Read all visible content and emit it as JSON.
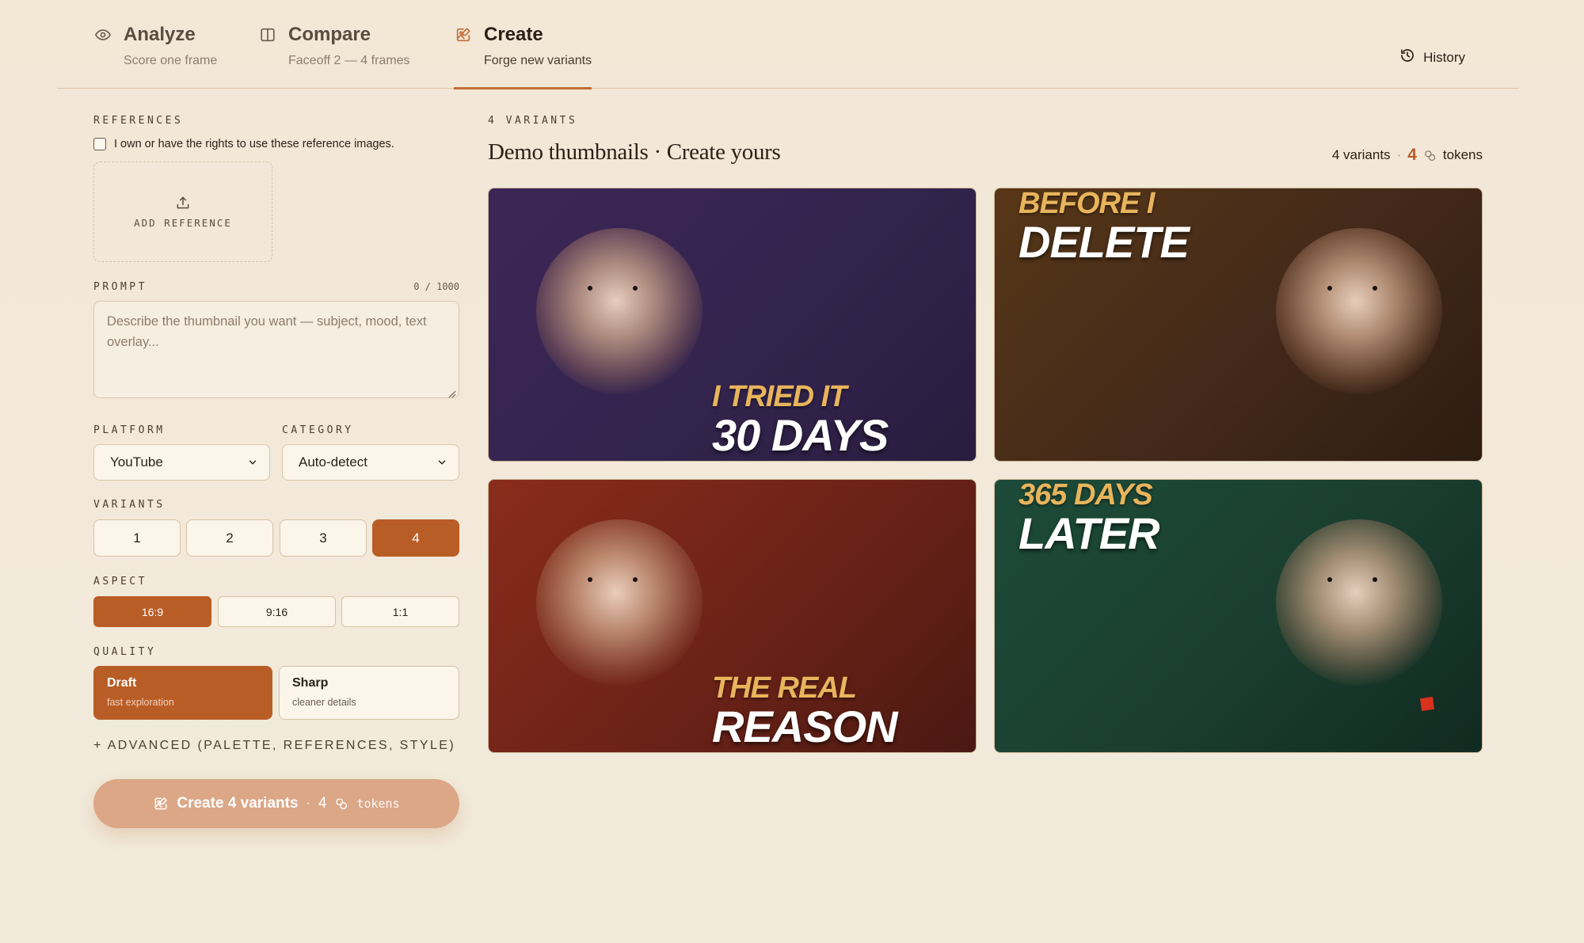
{
  "nav": {
    "tabs": [
      {
        "label": "Analyze",
        "sub": "Score one frame",
        "icon": "eye-icon"
      },
      {
        "label": "Compare",
        "sub": "Faceoff 2 — 4 frames",
        "icon": "columns-icon"
      },
      {
        "label": "Create",
        "sub": "Forge new variants",
        "icon": "image-edit-icon",
        "active": true
      }
    ],
    "history_label": "History"
  },
  "left": {
    "references_label": "REFERENCES",
    "rights_text": "I own or have the rights to use these reference images.",
    "add_reference_label": "ADD REFERENCE",
    "prompt_label": "PROMPT",
    "prompt_counter": "0 / 1000",
    "prompt_placeholder": "Describe the thumbnail you want — subject, mood, text overlay...",
    "platform_label": "PLATFORM",
    "platform_value": "YouTube",
    "category_label": "CATEGORY",
    "category_value": "Auto-detect",
    "variants_label": "VARIANTS",
    "variant_options": [
      "1",
      "2",
      "3",
      "4"
    ],
    "variant_selected": "4",
    "aspect_label": "ASPECT",
    "aspect_options": [
      "16:9",
      "9:16",
      "1:1"
    ],
    "aspect_selected": "16:9",
    "quality_label": "QUALITY",
    "quality_options": [
      {
        "title": "Draft",
        "sub": "fast exploration"
      },
      {
        "title": "Sharp",
        "sub": "cleaner details"
      }
    ],
    "quality_selected": "Draft",
    "advanced_label": "+ ADVANCED (PALETTE, REFERENCES, STYLE)",
    "create_button": {
      "label": "Create 4 variants",
      "separator": "·",
      "count": "4",
      "tokens": "tokens"
    }
  },
  "right": {
    "count_label": "4 VARIANTS",
    "headline": "Demo thumbnails · Create yours",
    "meta_variants": "4 variants",
    "meta_sep": "·",
    "meta_count": "4",
    "meta_tokens": "tokens",
    "cards": [
      {
        "top": "I TRIED IT",
        "bottom": "30 DAYS",
        "bg": "#3d2657"
      },
      {
        "top": "BEFORE I",
        "bottom": "DELETE",
        "bg": "#573717"
      },
      {
        "top": "THE REAL",
        "bottom": "REASON",
        "bg": "#8a2c1c"
      },
      {
        "top": "365 DAYS",
        "bottom": "LATER",
        "bg": "#1d4b39"
      }
    ]
  },
  "colors": {
    "accent": "#b95d26",
    "background": "#f2e9d9",
    "border": "#dcc6aa",
    "caption_gold": "#e8b45c"
  }
}
